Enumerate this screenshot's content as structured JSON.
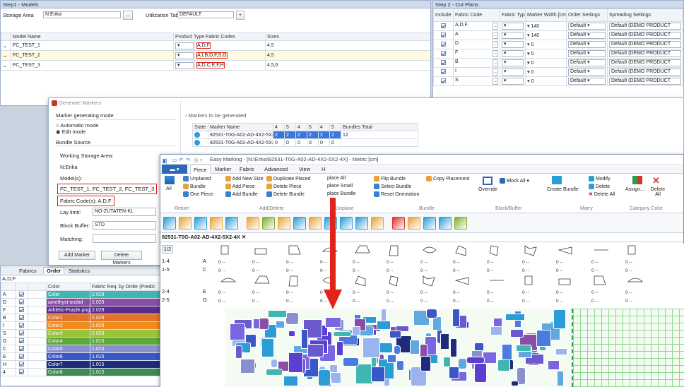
{
  "step1": {
    "title": "Step1 - Models",
    "storage_label": "Storage Area",
    "storage_value": "N:Erika",
    "util_label": "Utilization Table",
    "util_value": "DEFAULT",
    "cols": [
      "Model Name",
      "Product Type",
      "Fabric Codes",
      "Sizes"
    ],
    "rows": [
      {
        "name": "FC_TEST_1",
        "codes": "A,D,F",
        "sizes": "4,5"
      },
      {
        "name": "FC_TEST_2",
        "codes": "A,I,B,D,F,S,G",
        "sizes": "4,5"
      },
      {
        "name": "FC_TEST_3",
        "codes": "A,D,C,E,F,H",
        "sizes": "4,5,6"
      }
    ]
  },
  "step2": {
    "title": "Step 2 - Cut Plans",
    "cols": [
      "Include",
      "Fabric Code",
      "Fabric Type",
      "Marker Width [cm]",
      "Order Settings",
      "Spreading Settings"
    ],
    "rows": [
      {
        "code": "A,D,F",
        "width": "140",
        "order": "Default",
        "spread": "Default (DEMO PRODUCT"
      },
      {
        "code": "A",
        "width": "140",
        "order": "Default",
        "spread": "Default (DEMO PRODUCT"
      },
      {
        "code": "D",
        "width": "0",
        "order": "Default",
        "spread": "Default (DEMO PRODUCT"
      },
      {
        "code": "F",
        "width": "0",
        "order": "Default",
        "spread": "Default (DEMO PRODUCT"
      },
      {
        "code": "B",
        "width": "0",
        "order": "Default",
        "spread": "Default (DEMO PRODUCT"
      },
      {
        "code": "I",
        "width": "0",
        "order": "Default",
        "spread": "Default (DEMO PRODUCT"
      },
      {
        "code": "S",
        "width": "0",
        "order": "Default",
        "spread": "Default (DEMO PRODUCT"
      }
    ]
  },
  "gen": {
    "title": "Generate Markers",
    "mode_label": "Marker generating mode",
    "opt_auto": "Automatic mode",
    "opt_edit": "Edit mode",
    "bundle_label": "Bundle Source",
    "ws_label": "Working Storage Area:",
    "ws_value": "N:Erika",
    "models_label": "Model(s):",
    "models_value": "FC_TEST_1, FC_TEST_2, FC_TEST_3",
    "fc_label": "Fabric Code(s):",
    "fc_value": "A,D,F",
    "lay_label": "Lay limit:",
    "lay_value": "NO-ZUTATEN-KL",
    "buffer_label": "Block Buffer:",
    "buffer_value": "STD",
    "matching_label": "Matching:",
    "add_marker": "Add Marker",
    "delete_markers": "Delete Markers",
    "list_title": "Markers to be generated",
    "list_cols": [
      "State",
      "Marker Name",
      "4",
      "5",
      "4",
      "5",
      "4",
      "5",
      "Bundles Total"
    ],
    "list_rows": [
      {
        "name": "82531-T0G-A02-AD-4X2-5X2-4X",
        "vals": [
          "2",
          "2",
          "2",
          "2",
          "2",
          "2"
        ],
        "total": "12"
      },
      {
        "name": "82531-T0G-A02-AD-4X2-5X2",
        "vals": [
          "0",
          "0",
          "0",
          "0",
          "0",
          "0"
        ],
        "total": ""
      }
    ]
  },
  "em": {
    "title": "Easy Marking - [N:\\Erika\\82531-T0G-A02-AD-4X2-5X2-4X] - Metric [cm]",
    "tabs": [
      "Piece",
      "Marker",
      "Fabric",
      "Advanced",
      "View",
      "H"
    ],
    "ribbon": {
      "all": "All",
      "unplaced": "Unplaced",
      "bundle": "Bundle",
      "one_piece": "One Piece",
      "add_new_size": "Add New Size",
      "add_piece": "Add Piece",
      "add_bundle": "Add Bundle",
      "duplicate_placed": "Duplicate Placed",
      "delete_piece": "Delete Piece",
      "delete_bundle": "Delete Bundle",
      "place_all": "place All",
      "place_small": "place Small",
      "place_bundle": "place Bundle",
      "flip_bundle": "Flip Bundle",
      "select_bundle": "Select Bundle",
      "reset_orientation": "Reset Orientation",
      "copy_placement": "Copy Placement",
      "override": "Override",
      "block_all": "Block All",
      "create_bundle": "Create Bundle",
      "modify": "Modify",
      "delete": "Delete",
      "delete_all": "Delete All",
      "assign": "Assign...",
      "delete_all2": "Delete All",
      "groups": [
        "Return",
        "Add/Delete",
        "Unplace",
        "Bundle",
        "Block/Buffer",
        "Marry",
        "Category Color"
      ]
    },
    "doc_tab": "82531-T0G-A02-AD-4X2-5X2-4X",
    "ratio": "1/2",
    "rows": [
      {
        "id": "1-4",
        "s": "A"
      },
      {
        "id": "1-5",
        "s": "C"
      },
      {
        "id": "2-4",
        "s": "E"
      },
      {
        "id": "2-5",
        "s": "G"
      }
    ]
  },
  "order": {
    "tabs": [
      "Fabrics",
      "Order",
      "Statistics"
    ],
    "codes": "A,D,F",
    "cols": [
      "Color",
      "Fabric Req. by Order (Predic"
    ],
    "rows": [
      {
        "code": "A",
        "color": "Color",
        "req": "2.029",
        "bg": "#3fb6b0"
      },
      {
        "code": "D",
        "color": "amethyst orchid",
        "req": "2.029",
        "bg": "#8a4ea6"
      },
      {
        "code": "F",
        "color": "Athletic-Purple.png",
        "req": "2.029",
        "bg": "#5b2c8c"
      },
      {
        "code": "B",
        "color": "Color1",
        "req": "2.029",
        "bg": "#e2742a"
      },
      {
        "code": "I",
        "color": "Color2",
        "req": "2.029",
        "bg": "#f08c1e"
      },
      {
        "code": "S",
        "color": "Color3",
        "req": "2.029",
        "bg": "#9bc33a"
      },
      {
        "code": "G",
        "color": "Color4",
        "req": "1.015",
        "bg": "#5fa83c"
      },
      {
        "code": "C",
        "color": "Color5",
        "req": "1.015",
        "bg": "#8a8fcf"
      },
      {
        "code": "E",
        "color": "Color6",
        "req": "1.015",
        "bg": "#3a57c8"
      },
      {
        "code": "H",
        "color": "Color7",
        "req": "1.015",
        "bg": "#1e2d7a"
      },
      {
        "code": "4",
        "color": "Color8",
        "req": "1.015",
        "bg": "#3d8a56"
      }
    ]
  }
}
